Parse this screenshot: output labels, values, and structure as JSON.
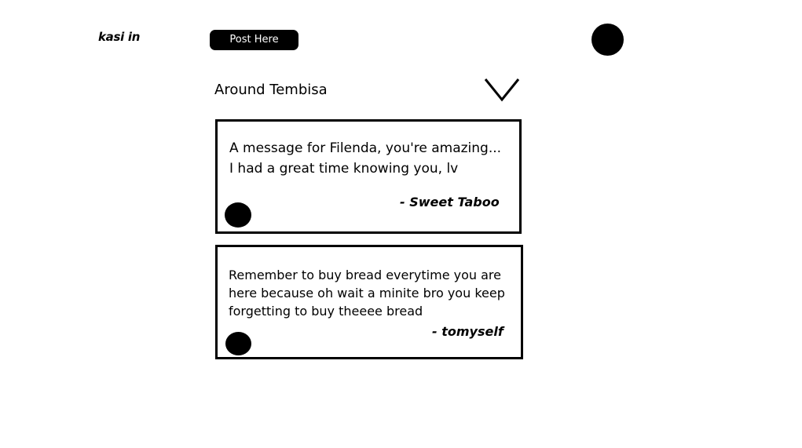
{
  "header": {
    "app_name": "kasi in",
    "post_button_label": "Post Here"
  },
  "feed": {
    "location": "Around Tembisa",
    "posts": [
      {
        "text": "A message for Filenda, you're amazing...\nI had a great time knowing you, lv",
        "author": "- Sweet Taboo"
      },
      {
        "text": "Remember to buy bread everytime you are\nhere because oh wait a minite bro you keep\nforgetting to buy theeee bread",
        "author": "- tomyself"
      }
    ]
  },
  "icons": {
    "profile_avatar": "avatar-circle",
    "location_dropdown": "chevron-down-icon",
    "post_avatar": "avatar-circle"
  },
  "colors": {
    "background": "#ffffff",
    "foreground": "#000000",
    "button_text": "#ffffff"
  }
}
